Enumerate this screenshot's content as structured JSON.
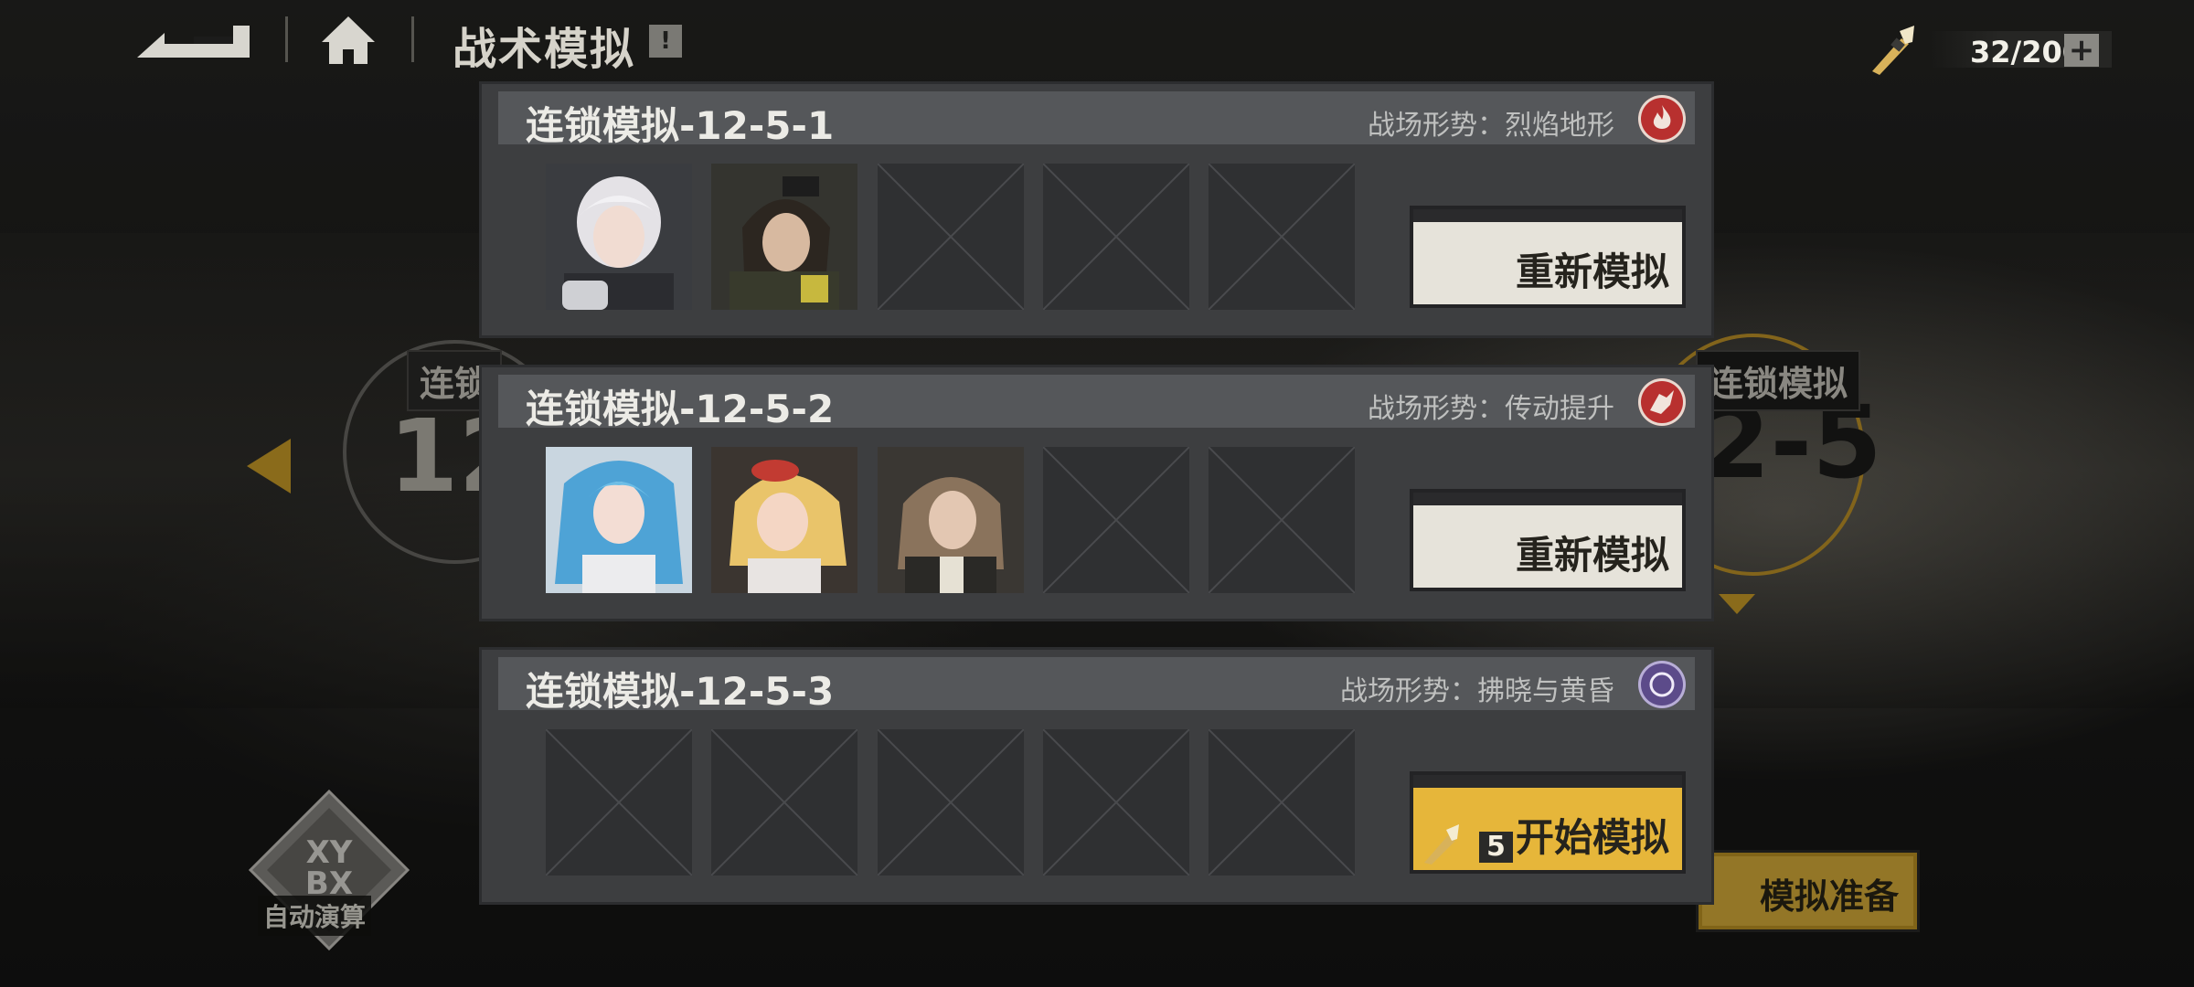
{
  "header": {
    "title": "战术模拟",
    "info_label": "!",
    "resource": {
      "count": "32/200",
      "plus_label": "+"
    }
  },
  "background": {
    "left_tag": "连锁",
    "left_stage": "12-",
    "right_tag": "连锁模拟",
    "right_stage": "2-5",
    "auto_label": "自动演算",
    "prepare_label": "模拟准备"
  },
  "cards": [
    {
      "title": "连锁模拟-12-5-1",
      "condition": "战场形势：烈焰地形",
      "condition_icon": "flame-icon",
      "filled_slots": 2,
      "action_label": "重新模拟"
    },
    {
      "title": "连锁模拟-12-5-2",
      "condition": "战场形势：传动提升",
      "condition_icon": "gear-boost-icon",
      "filled_slots": 3,
      "action_label": "重新模拟"
    },
    {
      "title": "连锁模拟-12-5-3",
      "condition": "战场形势：拂晓与黄昏",
      "condition_icon": "dawn-dusk-icon",
      "filled_slots": 0,
      "action_label": "开始模拟",
      "cost": "5"
    }
  ],
  "colors": {
    "accent_yellow": "#e6b63a",
    "condition_red": "#b8302f",
    "condition_purple": "#5c4b8a"
  }
}
